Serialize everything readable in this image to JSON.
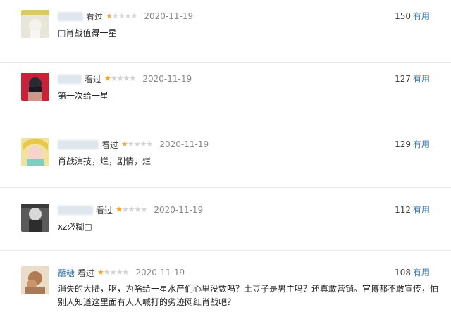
{
  "colors": {
    "link": "#3377aa",
    "star_on": "#f5a623",
    "star_off": "#d3d3d3"
  },
  "comments": [
    {
      "username": "",
      "watched": "看过",
      "rating": 1,
      "date": "2020-11-19",
      "votes": "150",
      "useful_label": "有用",
      "text": "□肖战值得一星"
    },
    {
      "username": "",
      "watched": "看过",
      "rating": 1,
      "date": "2020-11-19",
      "votes": "127",
      "useful_label": "有用",
      "text": "第一次给一星"
    },
    {
      "username": "",
      "watched": "看过",
      "rating": 1,
      "date": "2020-11-19",
      "votes": "129",
      "useful_label": "有用",
      "text": "肖战演技，烂，剧情，烂"
    },
    {
      "username": "",
      "watched": "看过",
      "rating": 1,
      "date": "2020-11-19",
      "votes": "112",
      "useful_label": "有用",
      "text": "xz必糊□"
    },
    {
      "username": "蘸糖",
      "watched": "看过",
      "rating": 1,
      "date": "2020-11-19",
      "votes": "108",
      "useful_label": "有用",
      "text": "消失的大陆，呕，为啥给一星水产们心里没数吗？土豆子是男主吗？还真敢营销。官博都不敢宣传，怕别人知道这里面有人人喊打的劣迹网红肖战吧？"
    }
  ]
}
